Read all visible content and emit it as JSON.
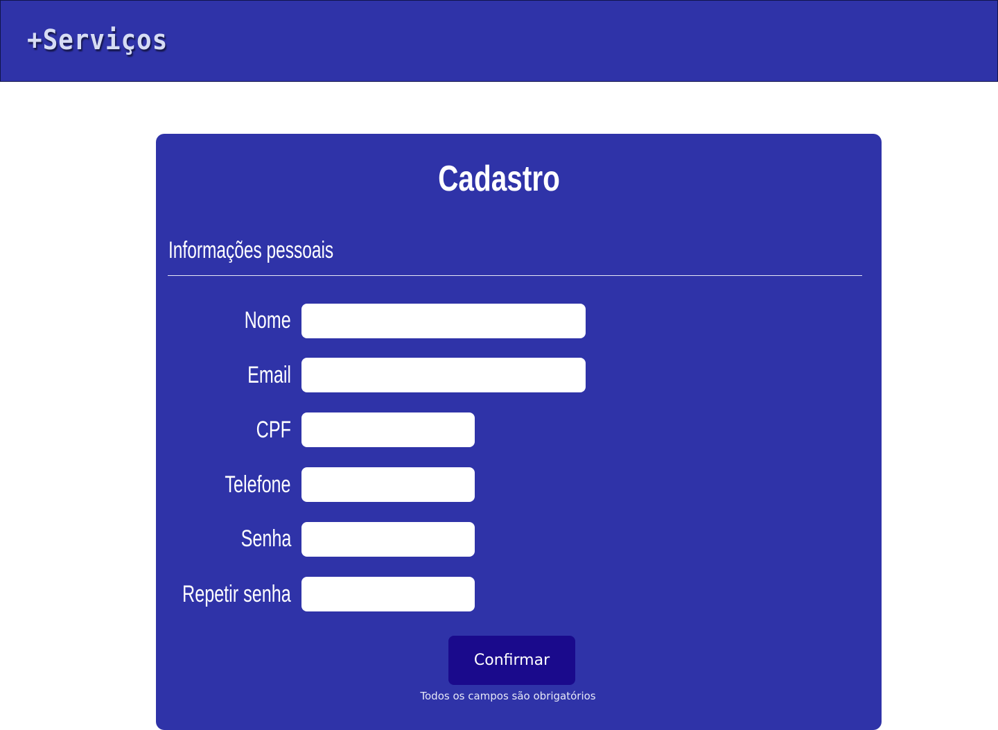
{
  "header": {
    "brand": "+Serviços"
  },
  "form": {
    "title": "Cadastro",
    "section_title": "Informações pessoais",
    "fields": [
      {
        "label": "Nome",
        "value": "",
        "placeholder": ""
      },
      {
        "label": "Email",
        "value": "",
        "placeholder": ""
      },
      {
        "label": "CPF",
        "value": "",
        "placeholder": ""
      },
      {
        "label": "Telefone",
        "value": "",
        "placeholder": ""
      },
      {
        "label": "Senha",
        "value": "",
        "placeholder": ""
      },
      {
        "label": "Repetir senha",
        "value": "",
        "placeholder": ""
      }
    ],
    "submit_label": "Confirmar",
    "required_note": "Todos os campos são obrigatórios"
  },
  "colors": {
    "primary": "#2f33a8",
    "button": "#1a0a8c",
    "text": "#ffffff"
  }
}
